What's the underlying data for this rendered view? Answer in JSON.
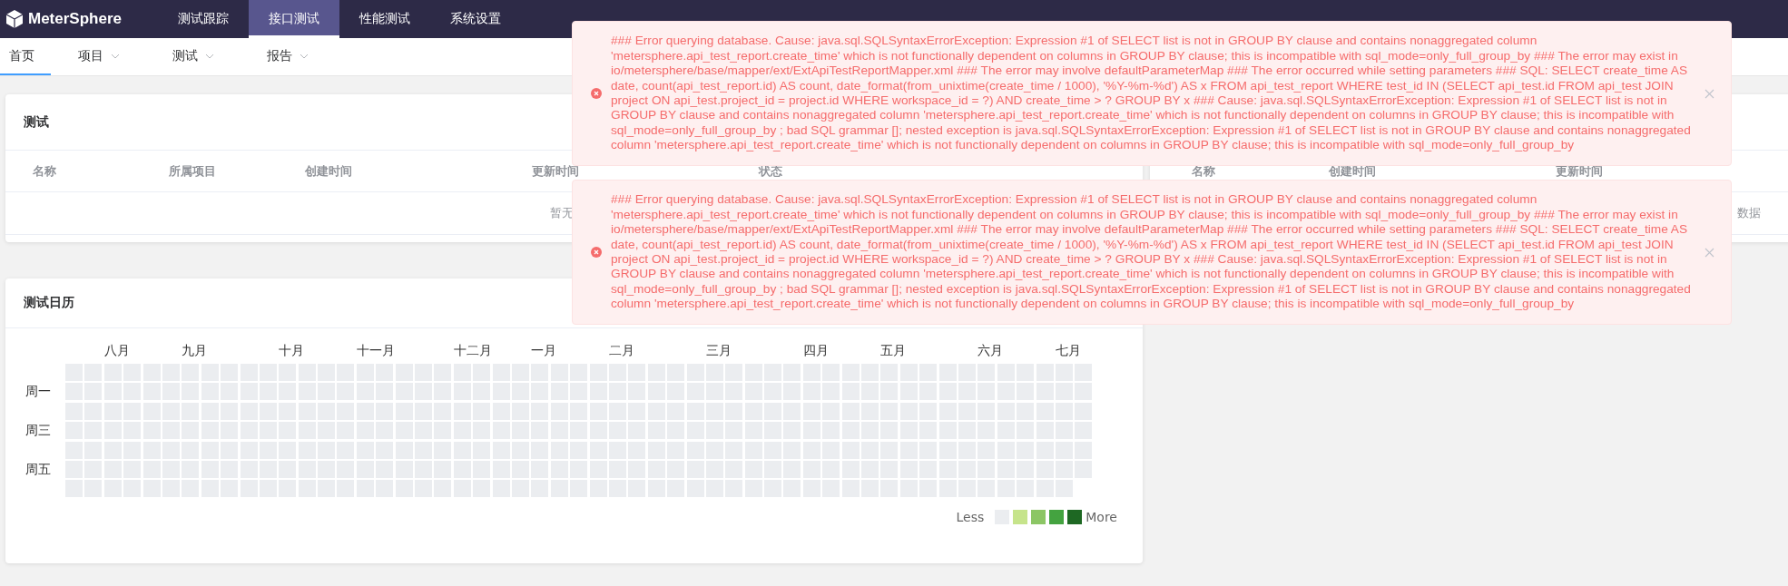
{
  "header": {
    "brand": "MeterSphere",
    "tabs": [
      {
        "label": "测试跟踪",
        "selected": false
      },
      {
        "label": "接口测试",
        "selected": true
      },
      {
        "label": "性能测试",
        "selected": false
      },
      {
        "label": "系统设置",
        "selected": false
      }
    ]
  },
  "subnav": [
    {
      "label": "首页",
      "selected": true,
      "dropdown": false
    },
    {
      "label": "项目",
      "selected": false,
      "dropdown": true
    },
    {
      "label": "测试",
      "selected": false,
      "dropdown": true
    },
    {
      "label": "报告",
      "selected": false,
      "dropdown": true
    }
  ],
  "tests_panel": {
    "title": "测试",
    "columns": [
      "名称",
      "所属项目",
      "创建时间",
      "更新时间",
      "状态"
    ],
    "empty_text": "暂无"
  },
  "calendar": {
    "title": "测试日历",
    "months": [
      "八月",
      "九月",
      "十月",
      "十一月",
      "十二月",
      "一月",
      "二月",
      "三月",
      "四月",
      "五月",
      "六月",
      "七月"
    ],
    "weekdays": [
      "周一",
      "周三",
      "周五"
    ],
    "legend": {
      "less": "Less",
      "more": "More",
      "swatches": [
        {
          "color": "#ebedf0"
        },
        {
          "color": "#c6e48b"
        },
        {
          "color": "#8cc665"
        },
        {
          "color": "#44a340"
        },
        {
          "color": "#1e6823"
        }
      ]
    }
  },
  "right_panel": {
    "columns": [
      "名称",
      "创建时间",
      "更新时间"
    ],
    "empty_text": "数据"
  },
  "notifications": [
    {
      "kind": "error",
      "message": "### Error querying database. Cause: java.sql.SQLSyntaxErrorException: Expression #1 of SELECT list is not in GROUP BY clause and contains nonaggregated column 'metersphere.api_test_report.create_time' which is not functionally dependent on columns in GROUP BY clause; this is incompatible with sql_mode=only_full_group_by ### The error may exist in io/metersphere/base/mapper/ext/ExtApiTestReportMapper.xml ### The error may involve defaultParameterMap ### The error occurred while setting parameters ### SQL: SELECT create_time AS date, count(api_test_report.id) AS count, date_format(from_unixtime(create_time / 1000), '%Y-%m-%d') AS x FROM api_test_report WHERE test_id IN (SELECT api_test.id FROM api_test JOIN project ON api_test.project_id = project.id WHERE workspace_id = ?) AND create_time > ? GROUP BY x ### Cause: java.sql.SQLSyntaxErrorException: Expression #1 of SELECT list is not in GROUP BY clause and contains nonaggregated column 'metersphere.api_test_report.create_time' which is not functionally dependent on columns in GROUP BY clause; this is incompatible with sql_mode=only_full_group_by ; bad SQL grammar []; nested exception is java.sql.SQLSyntaxErrorException: Expression #1 of SELECT list is not in GROUP BY clause and contains nonaggregated column 'metersphere.api_test_report.create_time' which is not functionally dependent on columns in GROUP BY clause; this is incompatible with sql_mode=only_full_group_by"
    },
    {
      "kind": "error",
      "message": "### Error querying database. Cause: java.sql.SQLSyntaxErrorException: Expression #1 of SELECT list is not in GROUP BY clause and contains nonaggregated column 'metersphere.api_test_report.create_time' which is not functionally dependent on columns in GROUP BY clause; this is incompatible with sql_mode=only_full_group_by ### The error may exist in io/metersphere/base/mapper/ext/ExtApiTestReportMapper.xml ### The error may involve defaultParameterMap ### The error occurred while setting parameters ### SQL: SELECT create_time AS date, count(api_test_report.id) AS count, date_format(from_unixtime(create_time / 1000), '%Y-%m-%d') AS x FROM api_test_report WHERE test_id IN (SELECT api_test.id FROM api_test JOIN project ON api_test.project_id = project.id WHERE workspace_id = ?) AND create_time > ? GROUP BY x ### Cause: java.sql.SQLSyntaxErrorException: Expression #1 of SELECT list is not in GROUP BY clause and contains nonaggregated column 'metersphere.api_test_report.create_time' which is not functionally dependent on columns in GROUP BY clause; this is incompatible with sql_mode=only_full_group_by ; bad SQL grammar []; nested exception is java.sql.SQLSyntaxErrorException: Expression #1 of SELECT list is not in GROUP BY clause and contains nonaggregated column 'metersphere.api_test_report.create_time' which is not functionally dependent on columns in GROUP BY clause; this is incompatible with sql_mode=only_full_group_by"
    }
  ]
}
